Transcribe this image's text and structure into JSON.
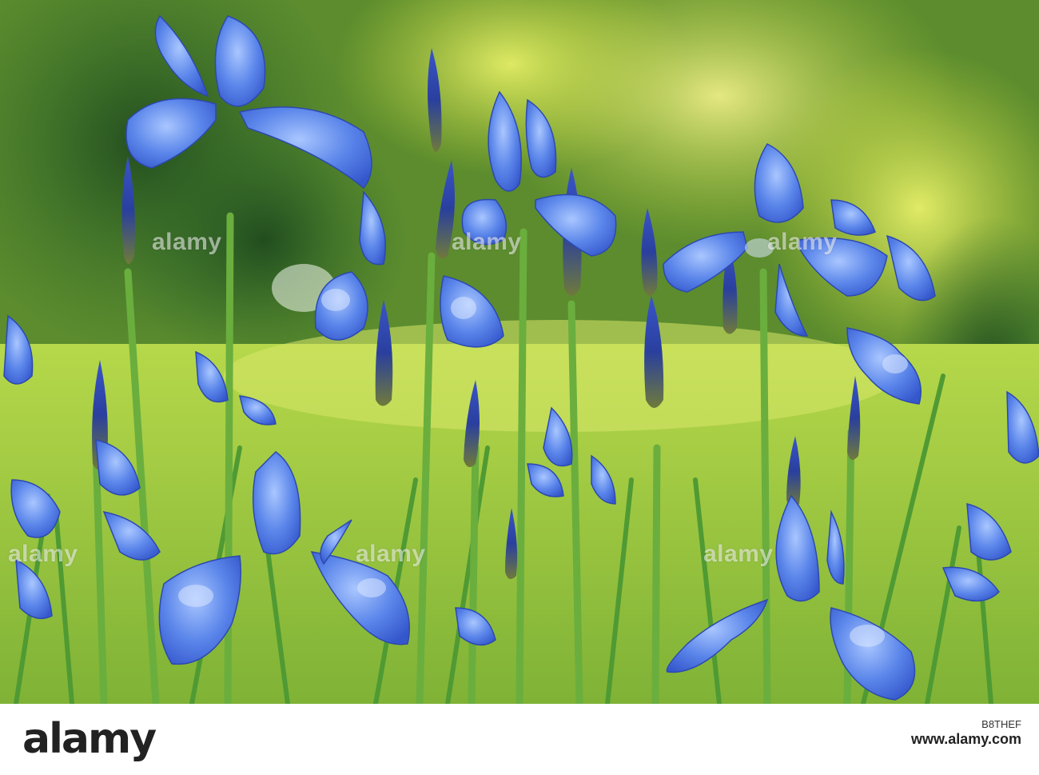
{
  "image": {
    "subject": "blue-irises",
    "colors": {
      "petal": "#4d7ae8",
      "petal_light": "#8fb4f5",
      "bud": "#3049b8",
      "stem": "#5fa43a",
      "foliage_dark": "#2f6a2a",
      "foliage_light": "#c4d83a",
      "lawn": "#a8d24a"
    }
  },
  "watermarks": [
    "alamy",
    "alamy",
    "alamy",
    "alamy",
    "alamy",
    "alamy"
  ],
  "footer": {
    "brand": "alamy",
    "image_code": "B8THEF",
    "url": "www.alamy.com"
  }
}
